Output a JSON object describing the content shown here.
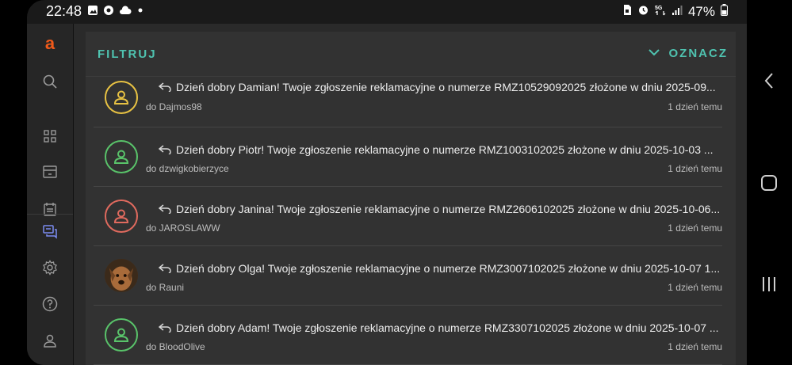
{
  "status_bar": {
    "time": "22:48",
    "left_icons": [
      "image-icon",
      "chrome-icon",
      "cloud-icon",
      "dot-icon"
    ],
    "right_icons": [
      "sim-icon",
      "alarm-icon",
      "5g-icon",
      "signal-icon"
    ],
    "battery": "47%"
  },
  "sidebar": {
    "logo": "a",
    "items": [
      {
        "icon": "search-icon"
      },
      {
        "icon": "grid-icon"
      },
      {
        "icon": "store-icon"
      },
      {
        "icon": "calendar-icon"
      },
      {
        "icon": "messages-icon"
      },
      {
        "icon": "gear-icon"
      },
      {
        "icon": "help-icon"
      },
      {
        "icon": "user-icon"
      }
    ]
  },
  "header": {
    "filter_label": "FILTRUJ",
    "mark_label": "OZNACZ"
  },
  "messages": [
    {
      "text": "Dzień dobry Damian! Twoje zgłoszenie reklamacyjne o numerze RMZ10529092025 złożone w dniu 2025-09...",
      "to": "do Dajmos98",
      "time": "1 dzień temu",
      "avatar_color": "#e8c243",
      "avatar_type": "placeholder"
    },
    {
      "text": "Dzień dobry Piotr! Twoje zgłoszenie reklamacyjne o numerze RMZ1003102025 złożone w dniu 2025-10-03 ...",
      "to": "do dzwigkobierzyce",
      "time": "1 dzień temu",
      "avatar_color": "#59c36a",
      "avatar_type": "placeholder"
    },
    {
      "text": "Dzień dobry Janina! Twoje zgłoszenie reklamacyjne o numerze RMZ2606102025 złożone w dniu 2025-10-06...",
      "to": "do JAROSLAWW",
      "time": "1 dzień temu",
      "avatar_color": "#e06a5e",
      "avatar_type": "placeholder"
    },
    {
      "text": "Dzień dobry Olga! Twoje zgłoszenie reklamacyjne o numerze RMZ3007102025 złożone w dniu 2025-10-07 1...",
      "to": "do Rauni",
      "time": "1 dzień temu",
      "avatar_color": "#8a5a2e",
      "avatar_type": "photo"
    },
    {
      "text": "Dzień dobry Adam! Twoje zgłoszenie reklamacyjne o numerze RMZ3307102025 złożone w dniu 2025-10-07 ...",
      "to": "do BloodOlive",
      "time": "1 dzień temu",
      "avatar_color": "#59c36a",
      "avatar_type": "placeholder"
    }
  ],
  "colors": {
    "accent": "#4fc3b0",
    "logo": "#f05a1a"
  }
}
